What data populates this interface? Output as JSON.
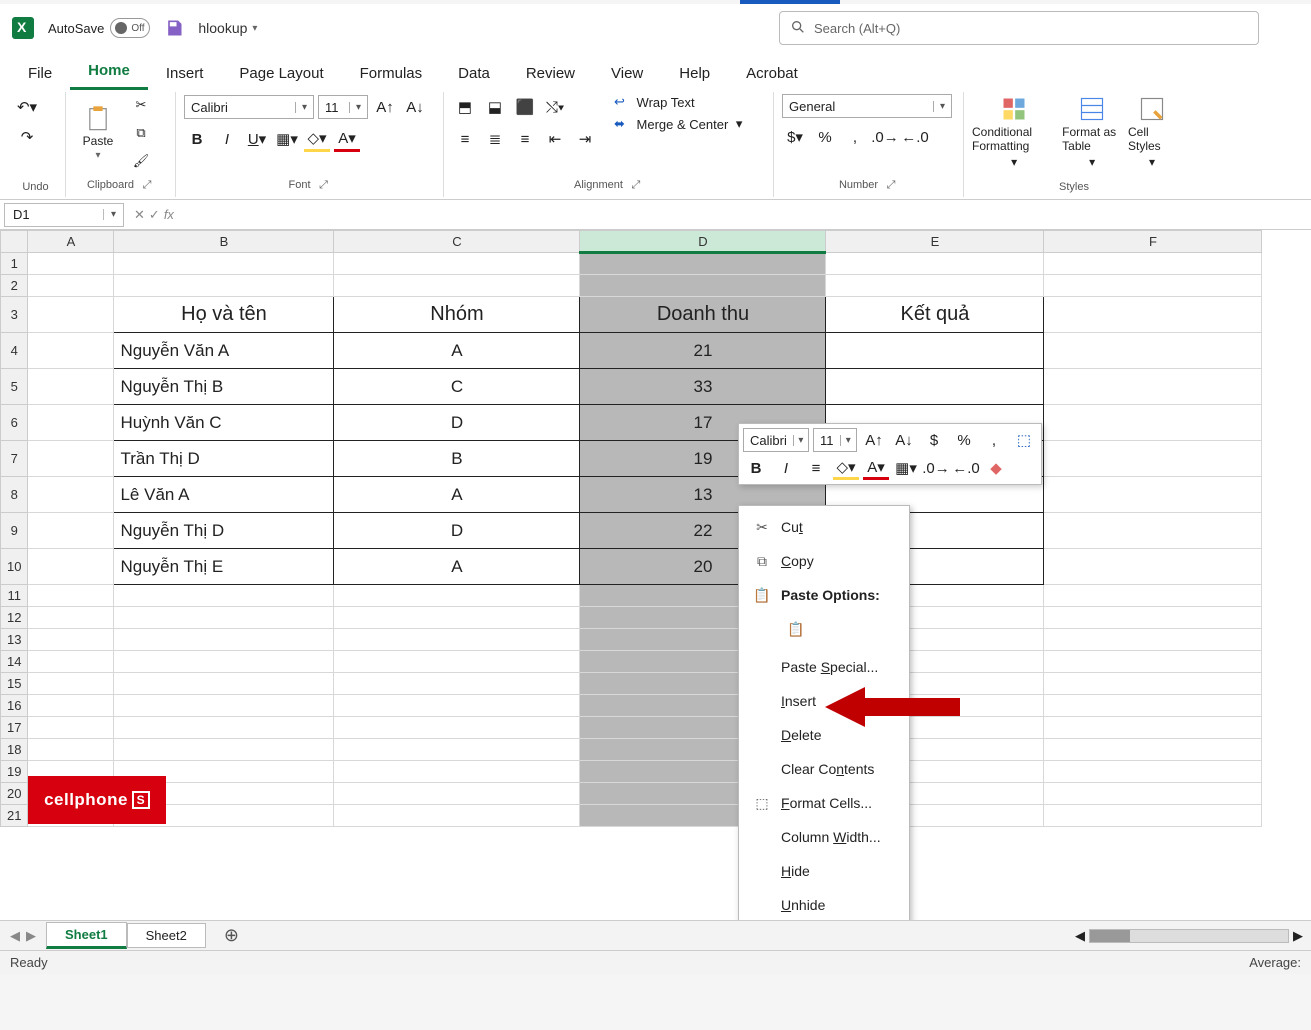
{
  "titlebar": {
    "autosave": "AutoSave",
    "autosave_state": "Off",
    "filename": "hlookup",
    "search_ph": "Search (Alt+Q)"
  },
  "tabs": [
    "File",
    "Home",
    "Insert",
    "Page Layout",
    "Formulas",
    "Data",
    "Review",
    "View",
    "Help",
    "Acrobat"
  ],
  "active_tab": 1,
  "ribbon": {
    "undo": "Undo",
    "clipboard": "Clipboard",
    "paste": "Paste",
    "font": "Font",
    "font_name": "Calibri",
    "font_size": "11",
    "alignment": "Alignment",
    "wrap": "Wrap Text",
    "merge": "Merge & Center",
    "number": "Number",
    "num_fmt": "General",
    "styles": "Styles",
    "condfmt": "Conditional Formatting",
    "fmttbl": "Format as Table",
    "cellsty": "Cell Styles"
  },
  "namebox": "D1",
  "formula": "",
  "cols": [
    "A",
    "B",
    "C",
    "D",
    "E",
    "F"
  ],
  "sel_col": "D",
  "sheet": {
    "header": [
      "Họ và tên",
      "Nhóm",
      "Doanh thu",
      "Kết quả"
    ],
    "rows": [
      {
        "name": "Nguyễn Văn A",
        "group": "A",
        "rev": "21"
      },
      {
        "name": "Nguyễn Thị B",
        "group": "C",
        "rev": "33"
      },
      {
        "name": "Huỳnh Văn C",
        "group": "D",
        "rev": "17"
      },
      {
        "name": "Trần Thị D",
        "group": "B",
        "rev": "19"
      },
      {
        "name": "Lê Văn A",
        "group": "A",
        "rev": "13"
      },
      {
        "name": "Nguyễn Thị D",
        "group": "D",
        "rev": "22"
      },
      {
        "name": "Nguyễn Thị E",
        "group": "A",
        "rev": "20"
      }
    ]
  },
  "mini": {
    "font": "Calibri",
    "size": "11"
  },
  "ctx": {
    "cut": "Cut",
    "copy": "Copy",
    "paste_opt": "Paste Options:",
    "paste_sp": "Paste Special...",
    "insert": "Insert",
    "delete": "Delete",
    "clear": "Clear Contents",
    "fmtcells": "Format Cells...",
    "colw": "Column Width...",
    "hide": "Hide",
    "unhide": "Unhide"
  },
  "sheets": [
    "Sheet1",
    "Sheet2"
  ],
  "status": {
    "ready": "Ready",
    "avg": "Average:"
  },
  "watermark": "cellphone"
}
